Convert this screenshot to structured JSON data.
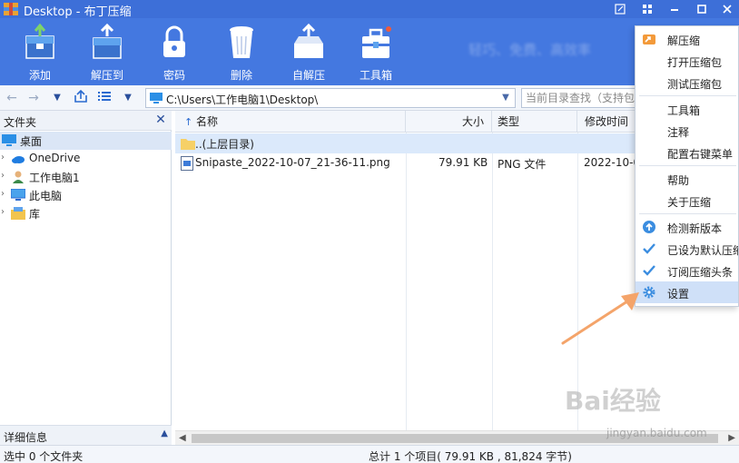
{
  "window": {
    "title": "Desktop - 布丁压缩",
    "controls": [
      "edit-icon",
      "grid-icon",
      "minimize-icon",
      "maximize-icon",
      "close-icon"
    ]
  },
  "toolbar": {
    "buttons": [
      {
        "label": "添加",
        "icon": "add-archive-icon"
      },
      {
        "label": "解压到",
        "icon": "extract-icon"
      },
      {
        "label": "密码",
        "icon": "lock-icon"
      },
      {
        "label": "删除",
        "icon": "trash-icon"
      },
      {
        "label": "自解压",
        "icon": "self-extract-icon"
      },
      {
        "label": "工具箱",
        "icon": "toolbox-icon"
      }
    ],
    "tagline": "轻巧、免费、高效率"
  },
  "navbar": {
    "address": "C:\\Users\\工作电脑1\\Desktop\\",
    "search_placeholder": "当前目录查找（支持包"
  },
  "left_panel": {
    "title": "文件夹",
    "tree": [
      {
        "label": "桌面",
        "icon": "desktop-icon",
        "selected": true
      },
      {
        "label": "OneDrive",
        "icon": "cloud-icon"
      },
      {
        "label": "工作电脑1",
        "icon": "user-icon"
      },
      {
        "label": "此电脑",
        "icon": "computer-icon"
      },
      {
        "label": "库",
        "icon": "library-icon"
      }
    ],
    "footer_label": "详细信息"
  },
  "file_list": {
    "columns": {
      "name": "名称",
      "size": "大小",
      "type": "类型",
      "modified": "修改时间"
    },
    "rows": [
      {
        "name": "..(上层目录)",
        "size": "",
        "type": "",
        "modified": "",
        "icon": "folder-icon"
      },
      {
        "name": "Snipaste_2022-10-07_21-36-11.png",
        "size": "79.91 KB",
        "type": "PNG 文件",
        "modified": "2022-10-0",
        "icon": "image-file-icon"
      }
    ]
  },
  "status": {
    "selection": "选中 0 个文件夹",
    "total": "总计 1 个项目( 79.91 KB , 81,824 字节)"
  },
  "menu": {
    "items": [
      {
        "label": "解压缩",
        "icon": "extract-arrow-icon"
      },
      {
        "label": "打开压缩包",
        "icon": ""
      },
      {
        "label": "测试压缩包",
        "icon": ""
      },
      {
        "label": "工具箱",
        "icon": ""
      },
      {
        "label": "注释",
        "icon": ""
      },
      {
        "label": "配置右键菜单",
        "icon": ""
      },
      {
        "label": "帮助",
        "icon": ""
      },
      {
        "label": "关于压缩",
        "icon": ""
      },
      {
        "label": "检测新版本",
        "icon": "upload-circle-icon"
      },
      {
        "label": "已设为默认压缩",
        "icon": "check-icon"
      },
      {
        "label": "订阅压缩头条",
        "icon": "check-icon"
      },
      {
        "label": "设置",
        "icon": "gear-icon"
      }
    ]
  },
  "watermark": {
    "logo": "Bai经验",
    "url": "jingyan.baidu.com"
  },
  "colors": {
    "titlebar": "#3d6fd8",
    "toolbar": "#4478e0",
    "selection": "#dbe9fb",
    "menu_highlight": "#cfe0f8",
    "accent": "#3b8de0",
    "annotation_arrow": "#f4a46a"
  }
}
